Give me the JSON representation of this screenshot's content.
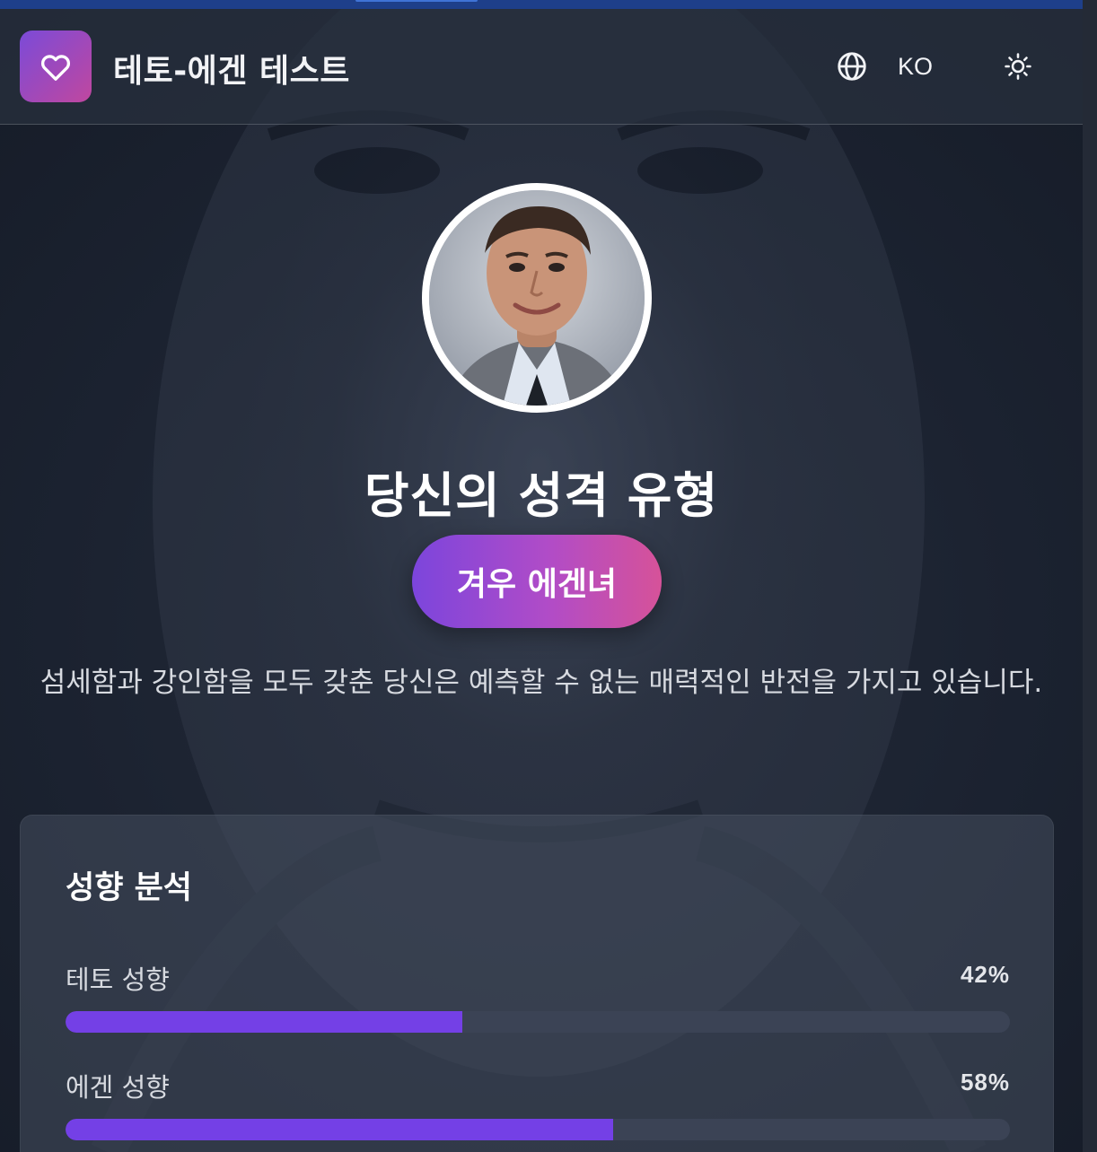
{
  "app": {
    "title": "테토-에겐 테스트",
    "language": "KO",
    "accent_gradient": [
      "#7b4bd8",
      "#c0479f"
    ]
  },
  "icons": {
    "logo": "heart-icon",
    "language": "globe-icon",
    "theme": "sun-icon"
  },
  "result": {
    "heading": "당신의 성격 유형",
    "type_label": "겨우 에겐녀",
    "description": "섬세함과 강인함을 모두 갖춘 당신은 예측할 수 없는 매력적인 반전을 가지고 있습니다."
  },
  "analysis": {
    "title": "성향 분석",
    "traits": [
      {
        "label": "테토 성향",
        "percent_text": "42%",
        "value": 42,
        "color": "#7440e6"
      },
      {
        "label": "에겐 성향",
        "percent_text": "58%",
        "value": 58,
        "color": "#7440e6"
      }
    ]
  }
}
